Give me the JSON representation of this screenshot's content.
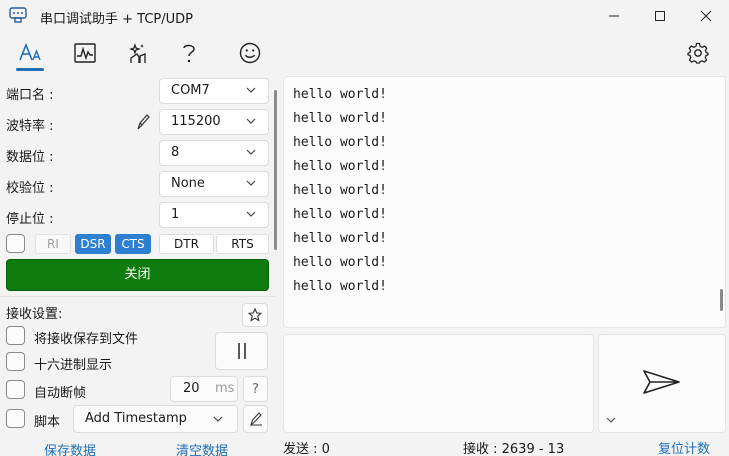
{
  "window": {
    "title": "串口调试助手 + TCP/UDP"
  },
  "toolbar": {
    "items": [
      "text-font-icon",
      "waveform-icon",
      "sparkle-edit-icon",
      "help-icon",
      "smiley-icon",
      "gear-icon"
    ]
  },
  "serial": {
    "port_label": "端口名 :",
    "port_value": "COM7",
    "baud_label": "波特率 :",
    "baud_value": "115200",
    "databits_label": "数据位 :",
    "databits_value": "8",
    "parity_label": "校验位 :",
    "parity_value": "None",
    "stopbits_label": "停止位 :",
    "stopbits_value": "1"
  },
  "signals": {
    "ri": "RI",
    "dsr": "DSR",
    "cts": "CTS",
    "dtr": "DTR",
    "rts": "RTS"
  },
  "close_button": "关闭",
  "receive": {
    "settings_label": "接收设置:",
    "save_to_file": "将接收保存到文件",
    "hex_display": "十六进制显示",
    "auto_frame": "自动断帧",
    "frame_ms_value": "20",
    "frame_ms_unit": "ms",
    "help_mark": "?",
    "script_label": "脚本",
    "timestamp_option": "Add Timestamp"
  },
  "bottom": {
    "save_data": "保存数据",
    "clear_data": "清空数据"
  },
  "received_lines": [
    "hello world!",
    "hello world!",
    "hello world!",
    "hello world!",
    "hello world!",
    "hello world!",
    "hello world!",
    "hello world!",
    "hello world!"
  ],
  "status": {
    "sent": "发送 : 0",
    "received": "接收 : 2639 - 13",
    "reset_count": "复位计数"
  },
  "colors": {
    "accent": "#1f6fb8",
    "close_button": "#0e7c0e",
    "signal_active": "#2d7fd2"
  }
}
